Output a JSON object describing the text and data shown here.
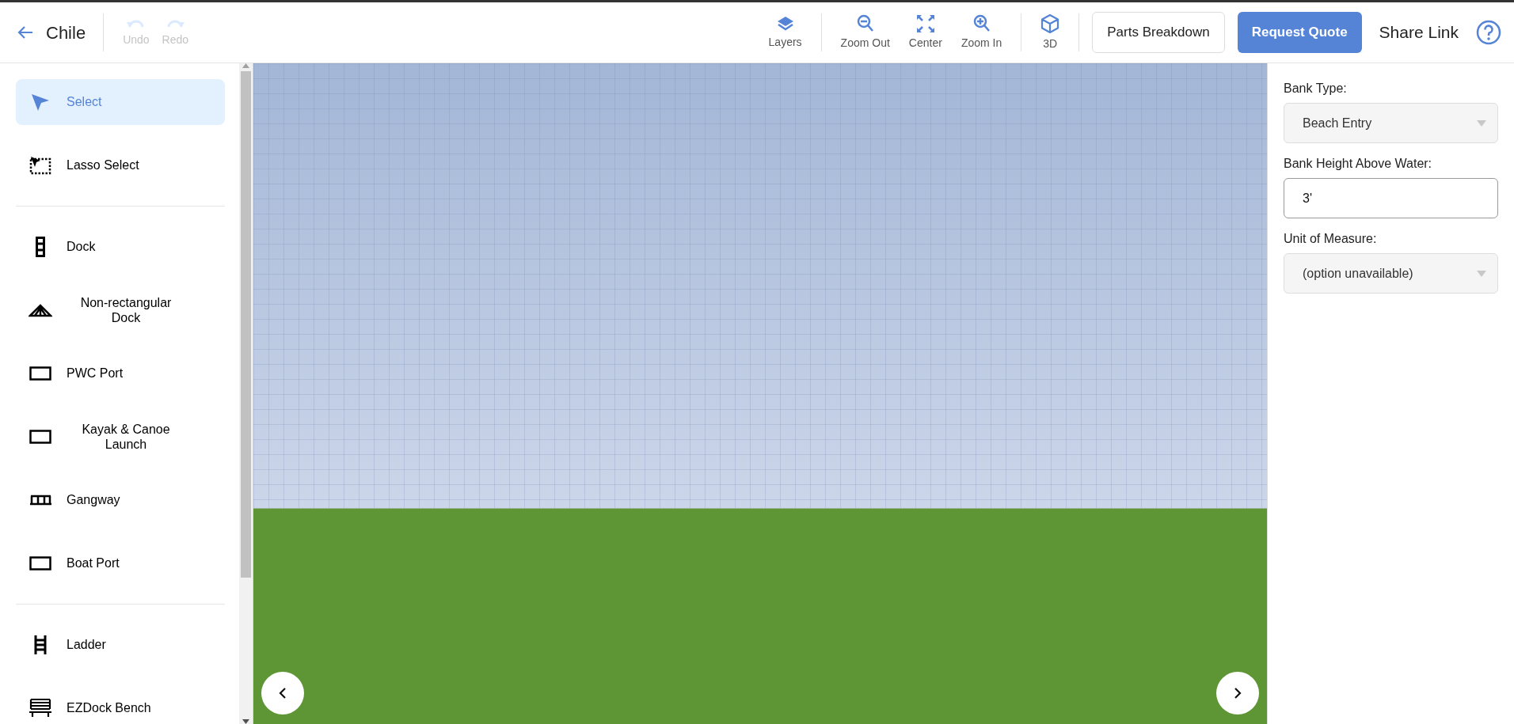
{
  "header": {
    "back_label": "Chile",
    "history": [
      {
        "label": "Undo",
        "kind": "undo",
        "disabled": true
      },
      {
        "label": "Redo",
        "kind": "redo",
        "disabled": true
      }
    ],
    "view_tools": [
      [
        {
          "label": "Layers",
          "kind": "layers"
        }
      ],
      [
        {
          "label": "Zoom Out",
          "kind": "zoom-out"
        },
        {
          "label": "Center",
          "kind": "center"
        },
        {
          "label": "Zoom In",
          "kind": "zoom-in"
        }
      ],
      [
        {
          "label": "3D",
          "kind": "cube"
        }
      ]
    ],
    "actions": [
      {
        "label": "Parts Breakdown",
        "kind": "outline"
      },
      {
        "label": "Request Quote",
        "kind": "primary"
      },
      {
        "label": "Share Link",
        "kind": "link"
      }
    ]
  },
  "sidebar": {
    "groups": [
      [
        {
          "label": "Select",
          "kind": "pointer",
          "selected": true
        },
        {
          "label": "Lasso Select",
          "kind": "lasso",
          "selected": false
        }
      ],
      [
        {
          "label": "Dock",
          "kind": "dock",
          "selected": false
        },
        {
          "label": "Non-rectangular Dock",
          "kind": "nonrect",
          "selected": false
        },
        {
          "label": "PWC Port",
          "kind": "rect",
          "selected": false
        },
        {
          "label": "Kayak & Canoe Launch",
          "kind": "rect",
          "selected": false
        },
        {
          "label": "Gangway",
          "kind": "gangway",
          "selected": false
        },
        {
          "label": "Boat Port",
          "kind": "rect",
          "selected": false
        }
      ],
      [
        {
          "label": "Ladder",
          "kind": "ladder",
          "selected": false
        },
        {
          "label": "EZDock Bench",
          "kind": "bench",
          "selected": false
        }
      ]
    ]
  },
  "properties": {
    "fields": [
      {
        "label": "Bank Type:",
        "kind": "select",
        "value": "Beach Entry",
        "disabled": true
      },
      {
        "label": "Bank Height Above Water:",
        "kind": "input",
        "value": "3'",
        "disabled": false
      },
      {
        "label": "Unit of Measure:",
        "kind": "select",
        "value": "(option unavailable)",
        "disabled": true
      }
    ]
  }
}
